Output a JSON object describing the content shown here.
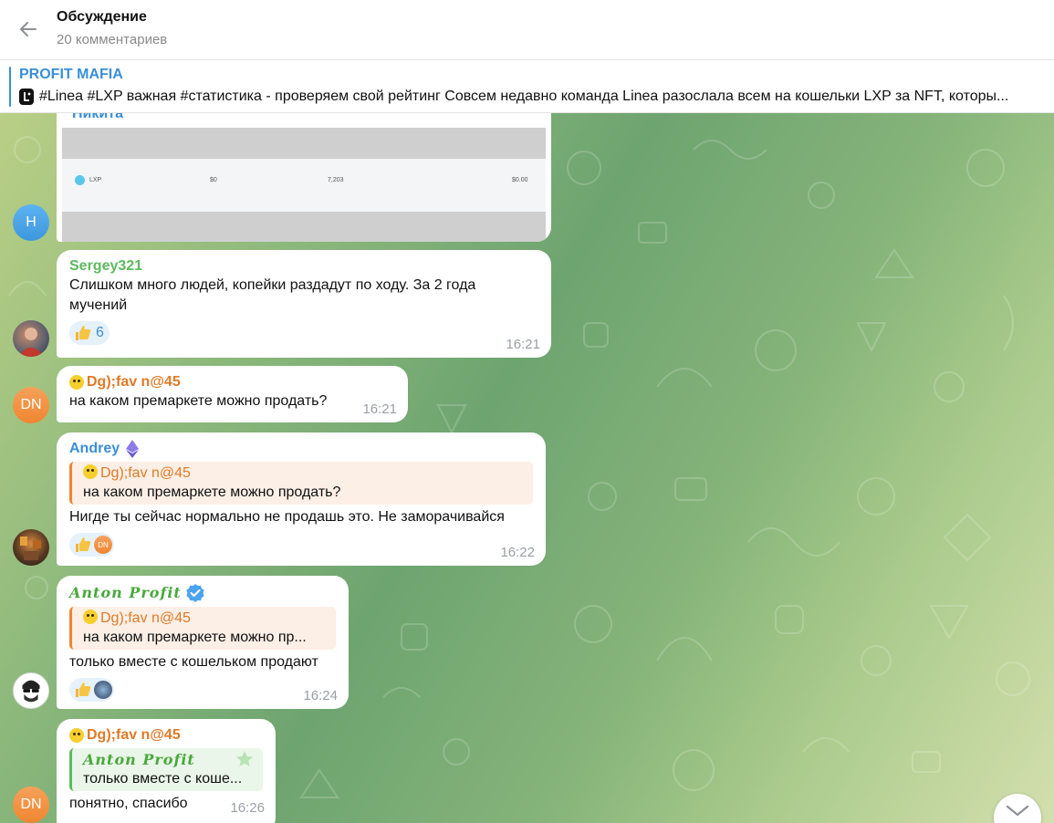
{
  "header": {
    "title": "Обсуждение",
    "subtitle": "20 комментариев"
  },
  "pinned": {
    "channel": "PROFIT MAFIA",
    "text": "#Linea #LXP важная #статистика - проверяем свой рейтинг  Совсем недавно команда Linea разослала всем на кошельки LXP за NFT, которы..."
  },
  "image_message": {
    "avatar_letter": "Н",
    "caption_partial": "Никита",
    "table_row": {
      "token": "LXP",
      "price": "$0",
      "amount": "7,203",
      "value": "$0.00"
    }
  },
  "messages": [
    {
      "sender": "Sergey321",
      "text": "Слишком много людей, копейки раздадут по ходу. За 2 года мучений",
      "reaction_count": "6",
      "time": "16:21"
    },
    {
      "sender": "Dg);fav n@45",
      "text": "на каком премаркете можно продать?",
      "time": "16:21",
      "avatar": "DN"
    },
    {
      "sender": "Andrey",
      "reply_name": "Dg);fav n@45",
      "reply_text": "на каком премаркете можно продать?",
      "text": "Нигде ты сейчас нормально не продашь это. Не заморачивайся",
      "reactor": "DN",
      "time": "16:22"
    },
    {
      "sender": "Anton Profit",
      "reply_name": "Dg);fav n@45",
      "reply_text": "на каком премаркете можно пр...",
      "text": "только вместе с кошельком продают",
      "time": "16:24"
    },
    {
      "sender": "Dg);fav n@45",
      "reply_name": "Anton Profit",
      "reply_text": "только вместе с коше...",
      "text": "понятно, спасибо",
      "time": "16:26",
      "avatar": "DN"
    }
  ],
  "colors": {
    "accent": "#3a8fd6",
    "sergey": "#5dba5e",
    "orange_user": "#e07a26",
    "andrey": "#3a8fd6"
  }
}
